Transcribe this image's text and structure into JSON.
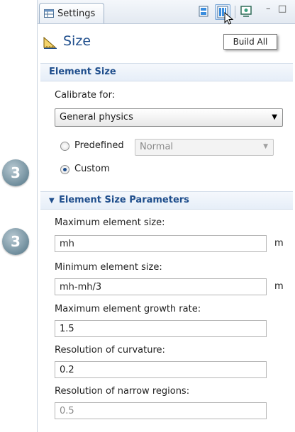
{
  "tab": {
    "label": "Settings",
    "icon": "settings-table-icon"
  },
  "toolbar": {
    "buttons": [
      "build-selected-icon",
      "build-all-icon",
      "graphics-icon"
    ]
  },
  "window_controls": {
    "minimize": "–",
    "maximize": "□"
  },
  "node": {
    "title": "Size",
    "icon": "size-ruler-icon"
  },
  "tooltip": "Build All",
  "element_size": {
    "header": "Element Size",
    "calibrate_label": "Calibrate for:",
    "calibrate_value": "General physics",
    "predefined_label": "Predefined",
    "predefined_value": "Normal",
    "custom_label": "Custom",
    "selected": "custom"
  },
  "parameters": {
    "header": "Element Size Parameters",
    "max_size_label": "Maximum element size:",
    "max_size_value": "mh",
    "max_size_unit": "m",
    "min_size_label": "Minimum element size:",
    "min_size_value": "mh-mh/3",
    "min_size_unit": "m",
    "growth_label": "Maximum element growth rate:",
    "growth_value": "1.5",
    "curvature_label": "Resolution of curvature:",
    "curvature_value": "0.2",
    "narrow_label": "Resolution of narrow regions:",
    "narrow_value": "0.5"
  },
  "steps": {
    "badge1": "3",
    "badge2": "3"
  },
  "colors": {
    "accent": "#1f4e8c",
    "badge": "#6f8d9c"
  }
}
